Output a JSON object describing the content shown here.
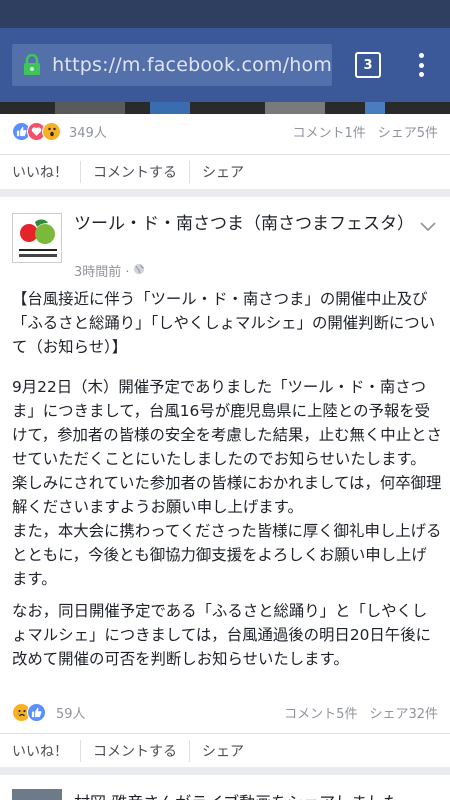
{
  "browser": {
    "url": "https://m.facebook.com/hom",
    "tab_count": "3"
  },
  "post1": {
    "reaction_count": "349人",
    "comments": "コメント1件",
    "shares": "シェア5件",
    "actions": [
      "いいね！",
      "コメントする",
      "シェア"
    ]
  },
  "post2": {
    "page_name": "ツール・ド・南さつま（南さつまフェスタ）",
    "time": "3時間前 · ",
    "paragraphs": [
      "【台風接近に伴う「ツール・ド・南さつま」の開催中止及び「ふるさと総踊り」「しやくしょマルシェ」の開催判断について（お知らせ）】",
      "9月22日（木）開催予定でありました「ツール・ド・南さつま」につきまして，台風16号が鹿児島県に上陸との予報を受けて，参加者の皆様の安全を考慮した結果，止む無く中止とさせていただくことにいたしましたのでお知らせいたします。\n楽しみにされていた参加者の皆様におかれましては，何卒御理解くださいますようお願い申し上げます。\nまた，本大会に携わってくださった皆様に厚く御礼申し上げるとともに，今後とも御協力御支援をよろしくお願い申し上げます。",
      "なお，同日開催予定である「ふるさと総踊り」と「しやくしょマルシェ」につきましては，台風通過後の明日20日午後に改めて開催の可否を判断しお知らせいたします。"
    ],
    "reaction_count": "59人",
    "comments": "コメント5件",
    "shares": "シェア32件",
    "actions": [
      "いいね！",
      "コメントする",
      "シェア"
    ]
  },
  "post3": {
    "title": "村岡 雅彦さんがライブ動画をシェアしました"
  },
  "colors": {
    "facebook_blue": "#3b5998",
    "like_blue": "#5890ff",
    "love_red": "#f25268",
    "wow_yellow": "#f7b125"
  },
  "icons": [
    "lock-icon",
    "tabs-icon",
    "overflow-menu-icon",
    "like-reaction-icon",
    "love-reaction-icon",
    "wow-reaction-icon",
    "sad-reaction-icon",
    "chevron-down-icon",
    "globe-icon"
  ]
}
